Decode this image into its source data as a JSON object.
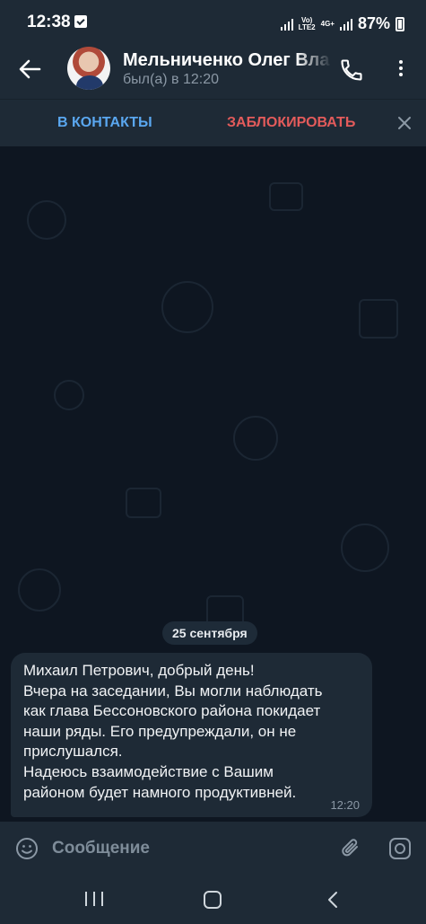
{
  "status_bar": {
    "time": "12:38",
    "network_top": "Vo)",
    "network_bottom": "LTE2",
    "network_gen": "4G+",
    "battery": "87%"
  },
  "header": {
    "contact_name": "Мельниченко Олег Вла",
    "last_seen": "был(а) в 12:20"
  },
  "action_bar": {
    "add_contact": "В КОНТАКТЫ",
    "block": "ЗАБЛОКИРОВАТЬ"
  },
  "chat": {
    "date_label": "25 сентября",
    "message": {
      "lines": [
        "Михаил Петрович, добрый день!",
        "Вчера на заседании, Вы могли наблюдать",
        "как глава Бессоновского района покидает",
        "наши ряды. Его предупреждали, он не",
        "прислушался.",
        "Надеюсь взаимодействие с Вашим",
        "районом будет намного продуктивней."
      ],
      "time": "12:20"
    }
  },
  "composer": {
    "placeholder": "Сообщение"
  },
  "colors": {
    "accent_blue": "#5aa7f0",
    "danger_red": "#e35b5b",
    "bar_bg": "#1e2a36",
    "chat_bg": "#0e1621"
  }
}
